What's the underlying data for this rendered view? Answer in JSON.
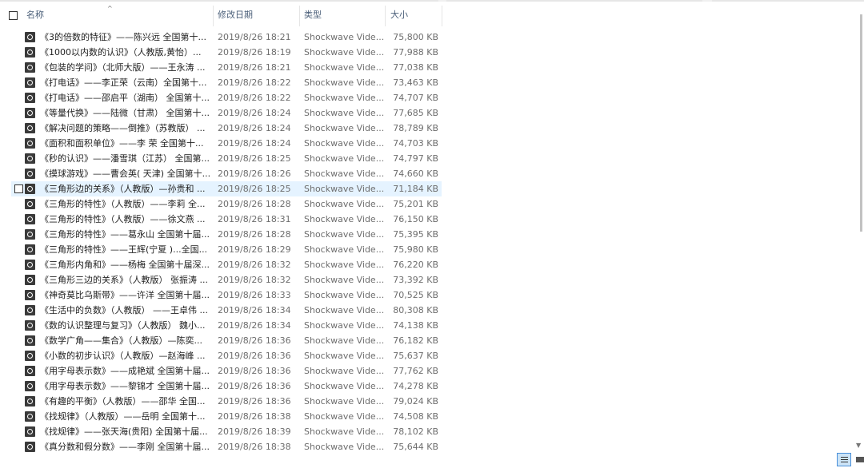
{
  "columns": {
    "name": "名称",
    "date": "修改日期",
    "type": "类型",
    "size": "大小"
  },
  "files": [
    {
      "name": "《3的倍数的特征》——陈兴远 全国第十...",
      "date": "2019/8/26 18:21",
      "type": "Shockwave Vide...",
      "size": "75,800 KB"
    },
    {
      "name": "《1000以内数的认识》（人教版,黄怡）...",
      "date": "2019/8/26 18:19",
      "type": "Shockwave Vide...",
      "size": "77,988 KB"
    },
    {
      "name": "《包装的学问》（北师大版）——王永涛 ...",
      "date": "2019/8/26 18:21",
      "type": "Shockwave Vide...",
      "size": "77,038 KB"
    },
    {
      "name": "《打电话》——李正荣（云南）全国第十...",
      "date": "2019/8/26 18:22",
      "type": "Shockwave Vide...",
      "size": "73,463 KB"
    },
    {
      "name": "《打电话》——邵启平（湖南） 全国第十...",
      "date": "2019/8/26 18:22",
      "type": "Shockwave Vide...",
      "size": "74,707 KB"
    },
    {
      "name": "《等量代换》——陆微（甘肃） 全国第十...",
      "date": "2019/8/26 18:24",
      "type": "Shockwave Vide...",
      "size": "77,685 KB"
    },
    {
      "name": "《解决问题的策略——倒推》（苏教版） ...",
      "date": "2019/8/26 18:24",
      "type": "Shockwave Vide...",
      "size": "78,789 KB"
    },
    {
      "name": "《面积和面积单位》——李 荣 全国第十...",
      "date": "2019/8/26 18:24",
      "type": "Shockwave Vide...",
      "size": "74,703 KB"
    },
    {
      "name": "《秒的认识》——潘雪琪（江苏） 全国第...",
      "date": "2019/8/26 18:25",
      "type": "Shockwave Vide...",
      "size": "74,797 KB"
    },
    {
      "name": "《摸球游戏》——曹会英( 天津) 全国第十...",
      "date": "2019/8/26 18:26",
      "type": "Shockwave Vide...",
      "size": "74,660 KB"
    },
    {
      "name": "《三角形边的关系》（人教版）—孙贵和 ...",
      "date": "2019/8/26 18:25",
      "type": "Shockwave Vide...",
      "size": "71,184 KB"
    },
    {
      "name": "《三角形的特性》（人教版）——李莉 全...",
      "date": "2019/8/26 18:28",
      "type": "Shockwave Vide...",
      "size": "75,201 KB"
    },
    {
      "name": "《三角形的特性》（人教版）——徐文燕 ...",
      "date": "2019/8/26 18:31",
      "type": "Shockwave Vide...",
      "size": "76,150 KB"
    },
    {
      "name": "《三角形的特性》——葛永山 全国第十届...",
      "date": "2019/8/26 18:28",
      "type": "Shockwave Vide...",
      "size": "75,395 KB"
    },
    {
      "name": "《三角形的特性》——王辉(宁夏 )...全国...",
      "date": "2019/8/26 18:29",
      "type": "Shockwave Vide...",
      "size": "75,980 KB"
    },
    {
      "name": "《三角形内角和》——杨梅 全国第十届深...",
      "date": "2019/8/26 18:32",
      "type": "Shockwave Vide...",
      "size": "76,220 KB"
    },
    {
      "name": "《三角形三边的关系》（人教版） 张振涛 ...",
      "date": "2019/8/26 18:32",
      "type": "Shockwave Vide...",
      "size": "73,392 KB"
    },
    {
      "name": "《神奇莫比乌斯带》——许洋 全国第十届...",
      "date": "2019/8/26 18:33",
      "type": "Shockwave Vide...",
      "size": "70,525 KB"
    },
    {
      "name": "《生活中的负数》（人教版） ——王卓伟 ...",
      "date": "2019/8/26 18:34",
      "type": "Shockwave Vide...",
      "size": "80,308 KB"
    },
    {
      "name": "《数的认识整理与复习》（人教版） 魏小...",
      "date": "2019/8/26 18:34",
      "type": "Shockwave Vide...",
      "size": "74,138 KB"
    },
    {
      "name": "《数学广角——集合》（人教版）—陈奕...",
      "date": "2019/8/26 18:36",
      "type": "Shockwave Vide...",
      "size": "76,182 KB"
    },
    {
      "name": "《小数的初步认识》（人教版）—赵海峰 ...",
      "date": "2019/8/26 18:36",
      "type": "Shockwave Vide...",
      "size": "75,637 KB"
    },
    {
      "name": "《用字母表示数》——成艳斌 全国第十届...",
      "date": "2019/8/26 18:36",
      "type": "Shockwave Vide...",
      "size": "77,762 KB"
    },
    {
      "name": "《用字母表示数》——黎锦才 全国第十届...",
      "date": "2019/8/26 18:36",
      "type": "Shockwave Vide...",
      "size": "74,278 KB"
    },
    {
      "name": "《有趣的平衡》（人教版）——邵华 全国...",
      "date": "2019/8/26 18:36",
      "type": "Shockwave Vide...",
      "size": "79,024 KB"
    },
    {
      "name": "《找规律》（人教版）——岳明 全国第十...",
      "date": "2019/8/26 18:38",
      "type": "Shockwave Vide...",
      "size": "74,508 KB"
    },
    {
      "name": "《找规律》——张天海(贵阳) 全国第十届...",
      "date": "2019/8/26 18:39",
      "type": "Shockwave Vide...",
      "size": "78,102 KB"
    },
    {
      "name": "《真分数和假分数》——李刚 全国第十届...",
      "date": "2019/8/26 18:38",
      "type": "Shockwave Vide...",
      "size": "75,644 KB"
    }
  ],
  "hover_row_index": 10,
  "view_buttons": [
    "details-view-icon",
    "large-icons-view-icon"
  ]
}
